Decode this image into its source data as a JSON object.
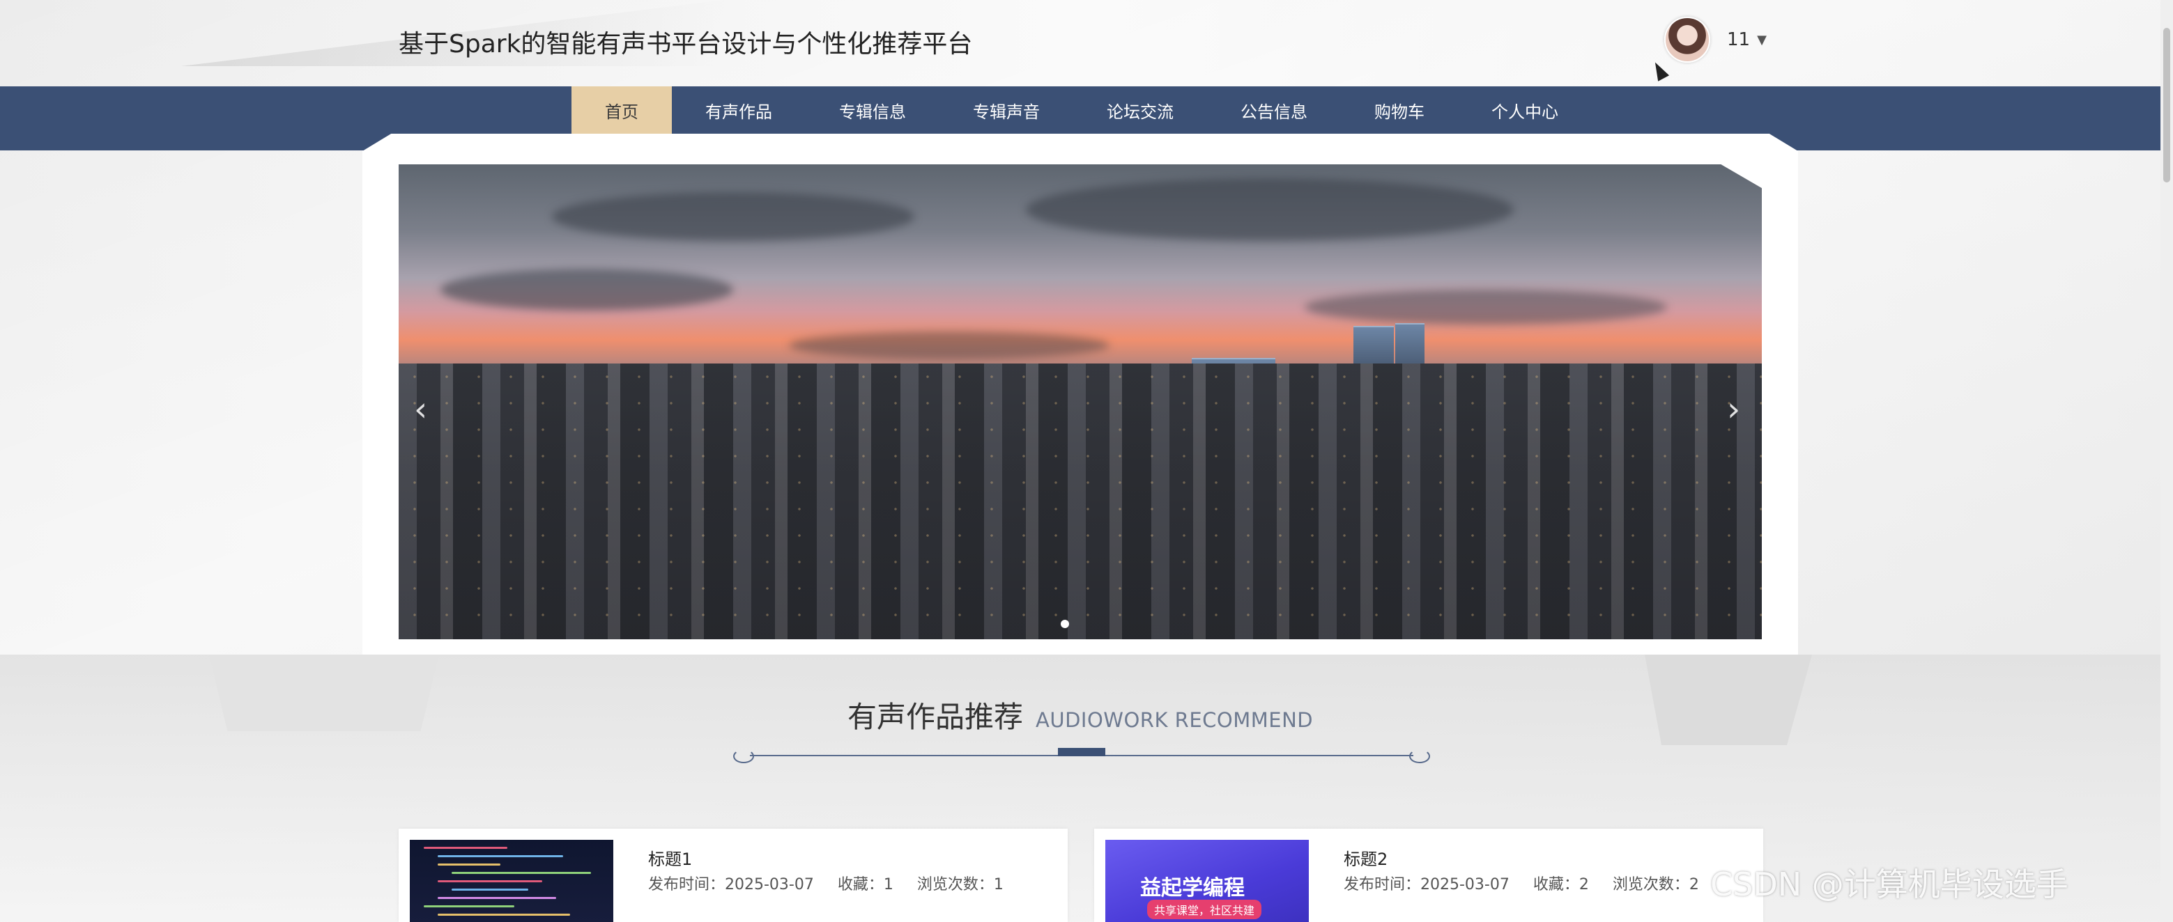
{
  "header": {
    "site_title": "基于Spark的智能有声书平台设计与个性化推荐平台",
    "username": "11",
    "caret": "▼"
  },
  "nav": {
    "items": [
      "首页",
      "有声作品",
      "专辑信息",
      "专辑声音",
      "论坛交流",
      "公告信息",
      "购物车",
      "个人中心"
    ],
    "active_index": 0
  },
  "carousel": {
    "prev_glyph": "‹",
    "next_glyph": "›",
    "slide_count": 1,
    "active_slide": 1
  },
  "section": {
    "title": "有声作品推荐",
    "subtitle": "AUDIOWORK RECOMMEND"
  },
  "cards": [
    {
      "title": "标题1",
      "date_label": "发布时间：2025-03-07",
      "fav_label": "收藏：1",
      "views_label": "浏览次数：1"
    },
    {
      "title": "标题2",
      "date_label": "发布时间：2025-03-07",
      "fav_label": "收藏：2",
      "views_label": "浏览次数：2",
      "thumb_text": "益起学编程",
      "thumb_small": "共享课堂，社区共建"
    }
  ],
  "watermark": "CSDN @计算机毕设选手",
  "colors": {
    "nav_bg": "#3b5075",
    "nav_active": "#e7cfa6",
    "accent": "#596b8c"
  }
}
